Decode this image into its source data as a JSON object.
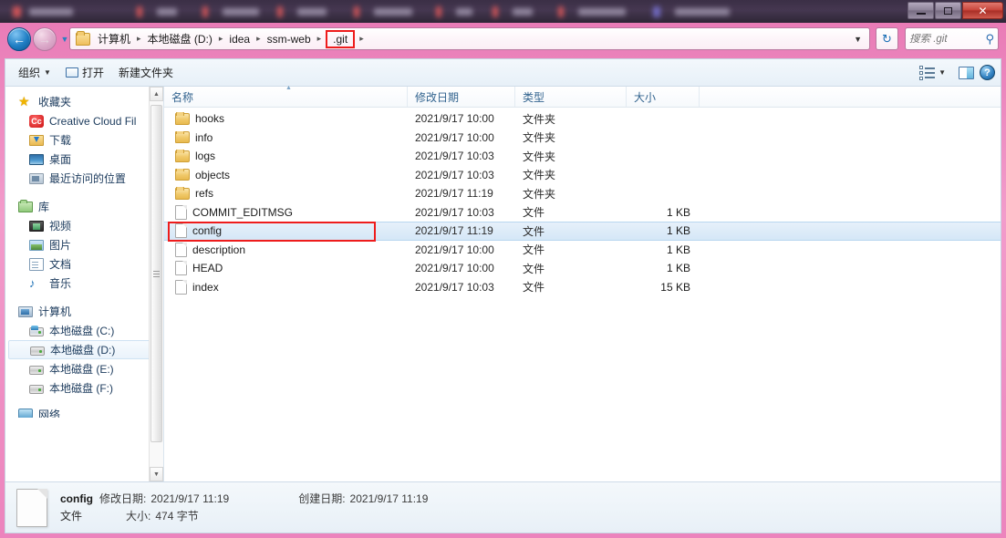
{
  "window": {
    "controls": {
      "minimize": "–",
      "maximize": "□",
      "close": "✕"
    }
  },
  "address": {
    "back_icon": "←",
    "forward_icon": "→",
    "history_caret": "▼",
    "breadcrumbs": [
      "计算机",
      "本地磁盘 (D:)",
      "idea",
      "ssm-web",
      ".git"
    ],
    "highlighted_crumb": ".git",
    "separator": "▸",
    "dropdown_caret": "▼",
    "refresh_icon": "↻"
  },
  "search": {
    "placeholder": "搜索 .git",
    "value": "",
    "icon": "⚲"
  },
  "toolbar": {
    "organize_label": "组织",
    "organize_caret": "▼",
    "open_label": "打开",
    "new_folder_label": "新建文件夹",
    "view_caret": "▼",
    "help_glyph": "?"
  },
  "sidebar": {
    "groups": [
      {
        "header": {
          "label": "收藏夹",
          "icon": "star-icon"
        },
        "items": [
          {
            "label": "Creative Cloud Fil",
            "icon": "creative-cloud-icon",
            "selected": false
          },
          {
            "label": "下载",
            "icon": "downloads-icon",
            "selected": false
          },
          {
            "label": "桌面",
            "icon": "desktop-icon",
            "selected": false
          },
          {
            "label": "最近访问的位置",
            "icon": "recent-places-icon",
            "selected": false
          }
        ]
      },
      {
        "header": {
          "label": "库",
          "icon": "library-icon"
        },
        "items": [
          {
            "label": "视频",
            "icon": "videos-icon",
            "selected": false
          },
          {
            "label": "图片",
            "icon": "pictures-icon",
            "selected": false
          },
          {
            "label": "文档",
            "icon": "documents-icon",
            "selected": false
          },
          {
            "label": "音乐",
            "icon": "music-icon",
            "selected": false
          }
        ]
      },
      {
        "header": {
          "label": "计算机",
          "icon": "computer-icon"
        },
        "items": [
          {
            "label": "本地磁盘 (C:)",
            "icon": "system-drive-icon",
            "selected": false
          },
          {
            "label": "本地磁盘 (D:)",
            "icon": "drive-icon",
            "selected": true
          },
          {
            "label": "本地磁盘 (E:)",
            "icon": "drive-icon",
            "selected": false
          },
          {
            "label": "本地磁盘 (F:)",
            "icon": "drive-icon",
            "selected": false
          }
        ]
      },
      {
        "header": {
          "label": "网络",
          "icon": "network-icon"
        },
        "items": []
      }
    ],
    "scroll": {
      "up_arrow": "▲",
      "down_arrow": "▼"
    }
  },
  "filelist": {
    "columns": [
      {
        "key": "name",
        "label": "名称",
        "sorted": true
      },
      {
        "key": "date",
        "label": "修改日期",
        "sorted": false
      },
      {
        "key": "type",
        "label": "类型",
        "sorted": false
      },
      {
        "key": "size",
        "label": "大小",
        "sorted": false
      }
    ],
    "rows": [
      {
        "name": "hooks",
        "date": "2021/9/17 10:00",
        "type": "文件夹",
        "size": "",
        "icon": "folder-icon",
        "selected": false,
        "marked": false
      },
      {
        "name": "info",
        "date": "2021/9/17 10:00",
        "type": "文件夹",
        "size": "",
        "icon": "folder-icon",
        "selected": false,
        "marked": false
      },
      {
        "name": "logs",
        "date": "2021/9/17 10:03",
        "type": "文件夹",
        "size": "",
        "icon": "folder-icon",
        "selected": false,
        "marked": false
      },
      {
        "name": "objects",
        "date": "2021/9/17 10:03",
        "type": "文件夹",
        "size": "",
        "icon": "folder-icon",
        "selected": false,
        "marked": false
      },
      {
        "name": "refs",
        "date": "2021/9/17 11:19",
        "type": "文件夹",
        "size": "",
        "icon": "folder-icon",
        "selected": false,
        "marked": false
      },
      {
        "name": "COMMIT_EDITMSG",
        "date": "2021/9/17 10:03",
        "type": "文件",
        "size": "1 KB",
        "icon": "file-icon",
        "selected": false,
        "marked": false
      },
      {
        "name": "config",
        "date": "2021/9/17 11:19",
        "type": "文件",
        "size": "1 KB",
        "icon": "file-icon",
        "selected": true,
        "marked": true
      },
      {
        "name": "description",
        "date": "2021/9/17 10:00",
        "type": "文件",
        "size": "1 KB",
        "icon": "file-icon",
        "selected": false,
        "marked": false
      },
      {
        "name": "HEAD",
        "date": "2021/9/17 10:00",
        "type": "文件",
        "size": "1 KB",
        "icon": "file-icon",
        "selected": false,
        "marked": false
      },
      {
        "name": "index",
        "date": "2021/9/17 10:03",
        "type": "文件",
        "size": "15 KB",
        "icon": "file-icon",
        "selected": false,
        "marked": false
      }
    ]
  },
  "details": {
    "name": "config",
    "modified_label": "修改日期:",
    "modified_value": "2021/9/17 11:19",
    "created_label": "创建日期:",
    "created_value": "2021/9/17 11:19",
    "type": "文件",
    "size_label": "大小:",
    "size_value": "474 字节"
  },
  "colors": {
    "frame": "#ec84bd",
    "annotation": "#ee1c1c",
    "selection": "#d5e7f7",
    "header_text": "#33648f",
    "close_button": "#c8443a"
  }
}
